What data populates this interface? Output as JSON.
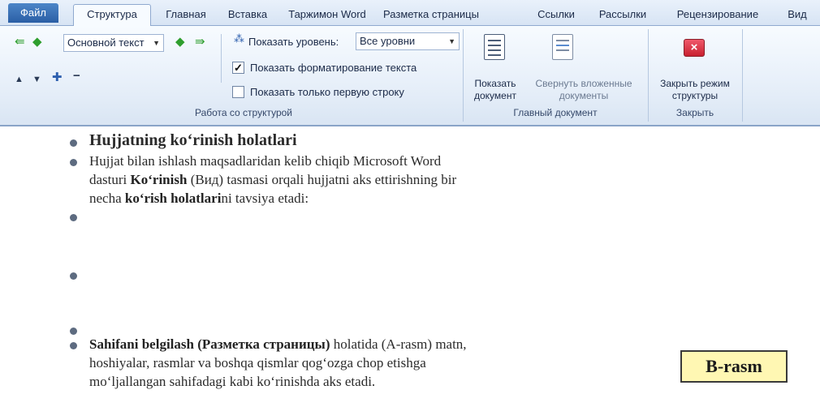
{
  "tabs": {
    "file": "Файл",
    "structure": "Структура",
    "home": "Главная",
    "insert": "Вставка",
    "translator": "Таржимон Word",
    "layout": "Разметка страницы",
    "references": "Ссылки",
    "mailings": "Рассылки",
    "review": "Рецензирование",
    "view": "Вид"
  },
  "outline_tools": {
    "level_combo": "Основной текст",
    "show_level_label": "Показать уровень:",
    "show_level_value": "Все уровни",
    "show_formatting": "Показать форматирование текста",
    "show_formatting_checked": true,
    "first_line_only": "Показать только первую строку",
    "first_line_only_checked": false,
    "group_label": "Работа со структурой"
  },
  "master_document": {
    "show_document": "Показать документ",
    "collapse_subdocuments": "Свернуть вложенные документы",
    "group_label": "Главный документ"
  },
  "close_group": {
    "close_outline": "Закрыть режим структуры",
    "group_label": "Закрыть"
  },
  "document": {
    "heading": "Hujjatning ko‘rinish holatlari",
    "p1_line1": "Hujjat bilan ishlash maqsadlaridan kelib chiqib Microsoft Word",
    "p1_line2_a": "dasturi ",
    "p1_line2_b": "Ko‘rinish",
    "p1_line2_c": " (Вид) tasmasi orqali hujjatni aks ettirishning bir",
    "p1_line3_a": "necha ",
    "p1_line3_b": "ko‘rish holatlari",
    "p1_line3_c": "ni tavsiya etadi:",
    "p2_line1_a": "Sahifani belgilash (Разметка страницы)",
    "p2_line1_b": " holatida (A-rasm) matn,",
    "p2_line2": "hoshiyalar, rasmlar va boshqa qismlar qog‘ozga chop etishga",
    "p2_line3": "mo‘ljallangan sahifadagi kabi ko‘rinishda aks etadi.",
    "badge": "B-rasm"
  }
}
